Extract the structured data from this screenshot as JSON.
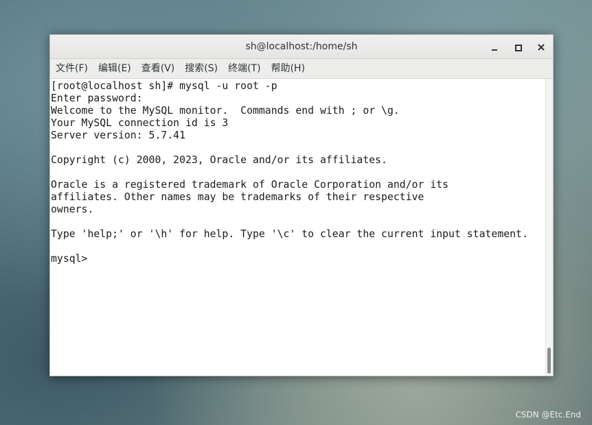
{
  "window": {
    "title": "sh@localhost:/home/sh"
  },
  "menu": [
    {
      "label": "文件(F)"
    },
    {
      "label": "编辑(E)"
    },
    {
      "label": "查看(V)"
    },
    {
      "label": "搜索(S)"
    },
    {
      "label": "终端(T)"
    },
    {
      "label": "帮助(H)"
    }
  ],
  "terminal": {
    "lines": [
      "[root@localhost sh]# mysql -u root -p",
      "Enter password:",
      "Welcome to the MySQL monitor.  Commands end with ; or \\g.",
      "Your MySQL connection id is 3",
      "Server version: 5.7.41",
      "",
      "Copyright (c) 2000, 2023, Oracle and/or its affiliates.",
      "",
      "Oracle is a registered trademark of Oracle Corporation and/or its",
      "affiliates. Other names may be trademarks of their respective",
      "owners.",
      "",
      "Type 'help;' or '\\h' for help. Type '\\c' to clear the current input statement.",
      "",
      "mysql> "
    ]
  },
  "icons": {
    "minimize": "minimize-icon",
    "maximize": "maximize-icon",
    "close": "close-icon"
  },
  "watermark": "CSDN @Etc.End"
}
